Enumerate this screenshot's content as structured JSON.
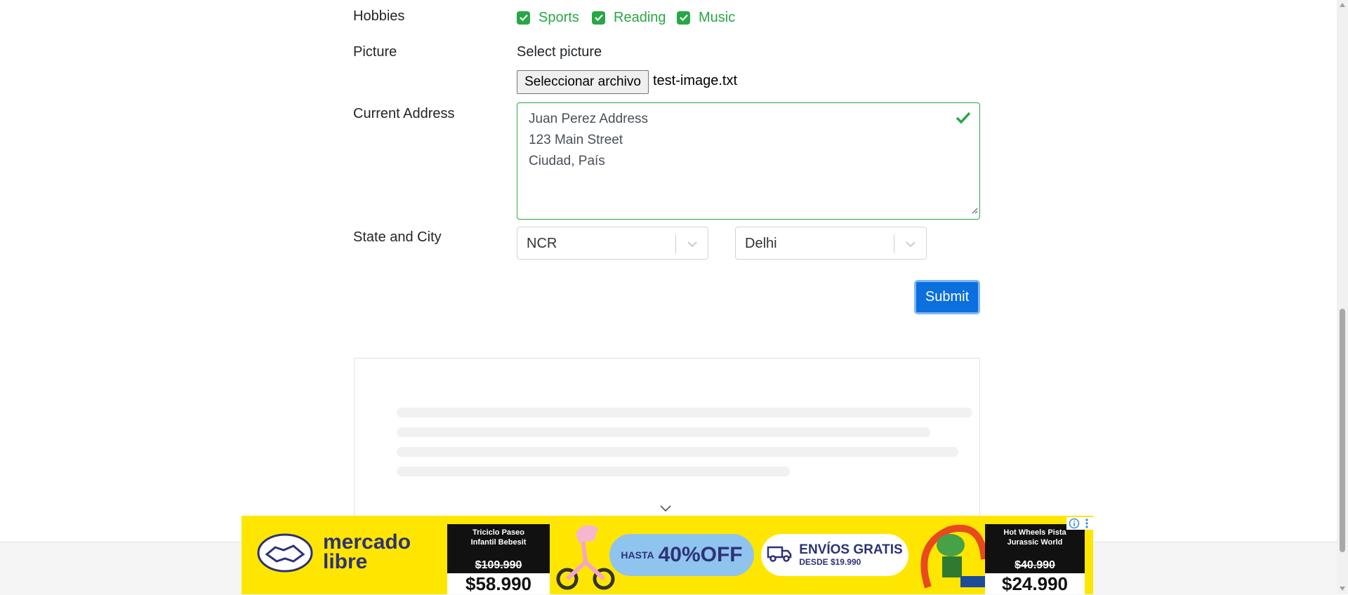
{
  "form": {
    "hobbies_label": "Hobbies",
    "hobbies": [
      "Sports",
      "Reading",
      "Music"
    ],
    "picture_label": "Picture",
    "select_picture_text": "Select picture",
    "file_button": "Seleccionar archivo",
    "file_name": "test-image.txt",
    "address_label": "Current Address",
    "address_lines": [
      "Juan Perez Address",
      "123 Main Street",
      "Ciudad, País"
    ],
    "state_city_label": "State and City",
    "state_value": "NCR",
    "city_value": "Delhi",
    "submit_label": "Submit"
  },
  "ad": {
    "brand_line1": "mercado",
    "brand_line2": "libre",
    "product1_title_line1": "Triciclo Paseo",
    "product1_title_line2": "Infantil Bebesit",
    "product1_old_price": "$109.990",
    "product1_price": "$58.990",
    "discount_prefix": "HASTA",
    "discount_value": "40%OFF",
    "shipping_title": "ENVÍOS GRATIS",
    "shipping_sub": "DESDE $19.990",
    "product2_title_line1": "Hot Wheels Pista",
    "product2_title_line2": "Jurassic World",
    "product2_old_price": "$40.990",
    "product2_price": "$24.990"
  },
  "colors": {
    "success": "#28a745",
    "primary": "#0b6fde",
    "ad_yellow": "#ffe600"
  }
}
